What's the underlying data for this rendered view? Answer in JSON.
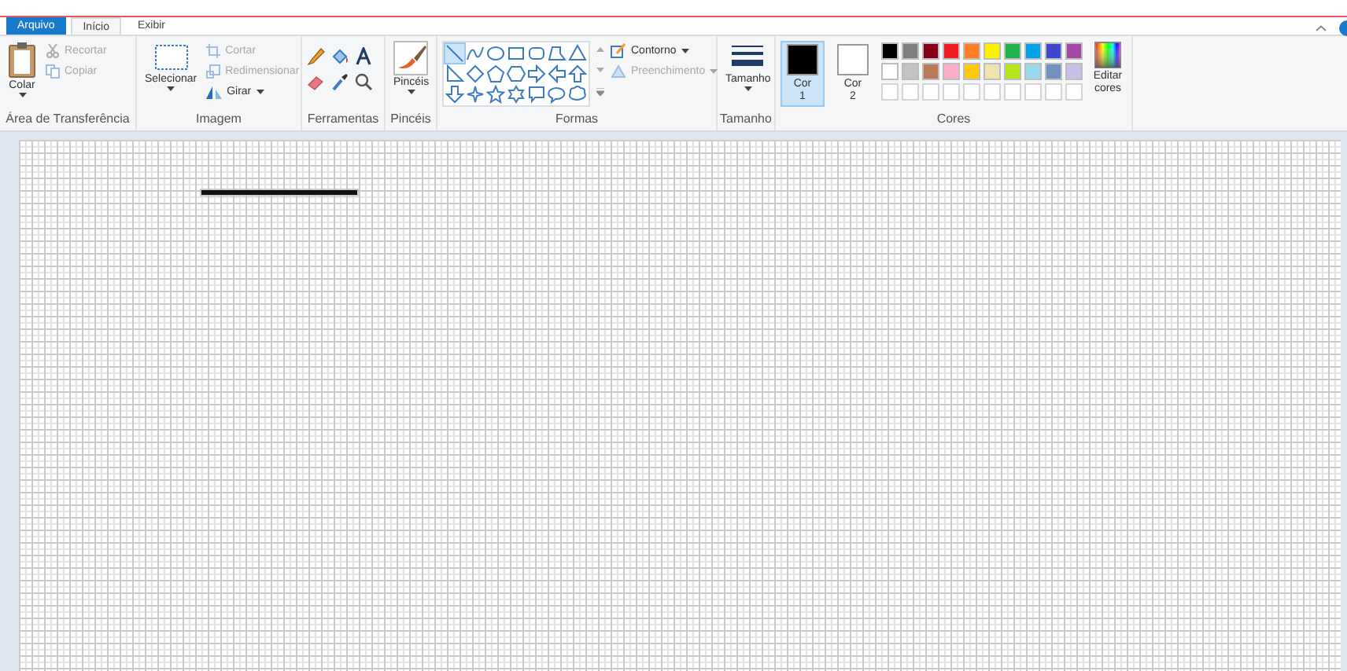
{
  "tabs": [
    {
      "label": "Arquivo",
      "kind": "file",
      "selected": false
    },
    {
      "label": "Início",
      "kind": "tab",
      "selected": true
    },
    {
      "label": "Exibir",
      "kind": "tab",
      "selected": false
    }
  ],
  "clipboard": {
    "paste": "Colar",
    "cut": {
      "label": "Recortar",
      "disabled": true
    },
    "copy": {
      "label": "Copiar",
      "disabled": true
    },
    "label": "Área de Transferência"
  },
  "image": {
    "select": "Selecionar",
    "crop": {
      "label": "Cortar",
      "disabled": true
    },
    "resize": {
      "label": "Redimensionar",
      "disabled": true
    },
    "rotate": {
      "label": "Girar",
      "disabled": false
    },
    "label": "Imagem"
  },
  "tools": {
    "label": "Ferramentas",
    "items": [
      {
        "kind": "pencil"
      },
      {
        "kind": "fill"
      },
      {
        "kind": "text"
      },
      {
        "kind": "eraser"
      },
      {
        "kind": "picker"
      },
      {
        "kind": "magnifier"
      }
    ]
  },
  "brushes": {
    "label": "Pincéis",
    "group_label": "Pincéis"
  },
  "shapes": {
    "label": "Formas",
    "outline": {
      "label": "Contorno",
      "disabled": false
    },
    "fill": {
      "label": "Preenchimento",
      "disabled": true
    },
    "items": [
      {
        "kind": "line",
        "selected": true
      },
      {
        "kind": "curve",
        "selected": false
      },
      {
        "kind": "oval",
        "selected": false
      },
      {
        "kind": "rectangle",
        "selected": false
      },
      {
        "kind": "rounded",
        "selected": false
      },
      {
        "kind": "polygon",
        "selected": false
      },
      {
        "kind": "triangle",
        "selected": false
      },
      {
        "kind": "right-triangle",
        "selected": false
      },
      {
        "kind": "diamond",
        "selected": false
      },
      {
        "kind": "pentagon",
        "selected": false
      },
      {
        "kind": "hexagon",
        "selected": false
      },
      {
        "kind": "right-arrow",
        "selected": false
      },
      {
        "kind": "left-arrow",
        "selected": false
      },
      {
        "kind": "up-arrow",
        "selected": false
      },
      {
        "kind": "down-arrow",
        "selected": false
      },
      {
        "kind": "star4",
        "selected": false
      },
      {
        "kind": "star5",
        "selected": false
      },
      {
        "kind": "star6",
        "selected": false
      },
      {
        "kind": "bubble-rect",
        "selected": false
      },
      {
        "kind": "bubble-oval",
        "selected": false
      },
      {
        "kind": "bubble-cloud",
        "selected": false
      }
    ]
  },
  "size": {
    "label": "Tamanho",
    "group_label": "Tamanho"
  },
  "colors": {
    "label": "Cores",
    "edit": "Editar cores",
    "slots": [
      {
        "name": "Cor",
        "number": "1",
        "color": "#000000",
        "selected": true
      },
      {
        "name": "Cor",
        "number": "2",
        "color": "#ffffff",
        "selected": false
      }
    ],
    "palette": [
      [
        {
          "kind": "swatch",
          "color": "#000000"
        },
        {
          "kind": "swatch",
          "color": "#7f7f7f"
        },
        {
          "kind": "swatch",
          "color": "#880015"
        },
        {
          "kind": "swatch",
          "color": "#ed1c24"
        },
        {
          "kind": "swatch",
          "color": "#ff7f27"
        },
        {
          "kind": "swatch",
          "color": "#fff200"
        },
        {
          "kind": "swatch",
          "color": "#22b14c"
        },
        {
          "kind": "swatch",
          "color": "#00a2e8"
        },
        {
          "kind": "swatch",
          "color": "#3f48cc"
        },
        {
          "kind": "swatch",
          "color": "#a349a4"
        }
      ],
      [
        {
          "kind": "swatch",
          "color": "#ffffff"
        },
        {
          "kind": "swatch",
          "color": "#c3c3c3"
        },
        {
          "kind": "swatch",
          "color": "#b97a57"
        },
        {
          "kind": "swatch",
          "color": "#ffaec9"
        },
        {
          "kind": "swatch",
          "color": "#ffc90e"
        },
        {
          "kind": "swatch",
          "color": "#efe4b0"
        },
        {
          "kind": "swatch",
          "color": "#b5e61d"
        },
        {
          "kind": "swatch",
          "color": "#99d9ea"
        },
        {
          "kind": "swatch",
          "color": "#7092be"
        },
        {
          "kind": "swatch",
          "color": "#c8bfe7"
        }
      ],
      [
        {
          "kind": "empty"
        },
        {
          "kind": "empty"
        },
        {
          "kind": "empty"
        },
        {
          "kind": "empty"
        },
        {
          "kind": "empty"
        },
        {
          "kind": "empty"
        },
        {
          "kind": "empty"
        },
        {
          "kind": "empty"
        },
        {
          "kind": "empty"
        },
        {
          "kind": "empty"
        }
      ]
    ]
  }
}
